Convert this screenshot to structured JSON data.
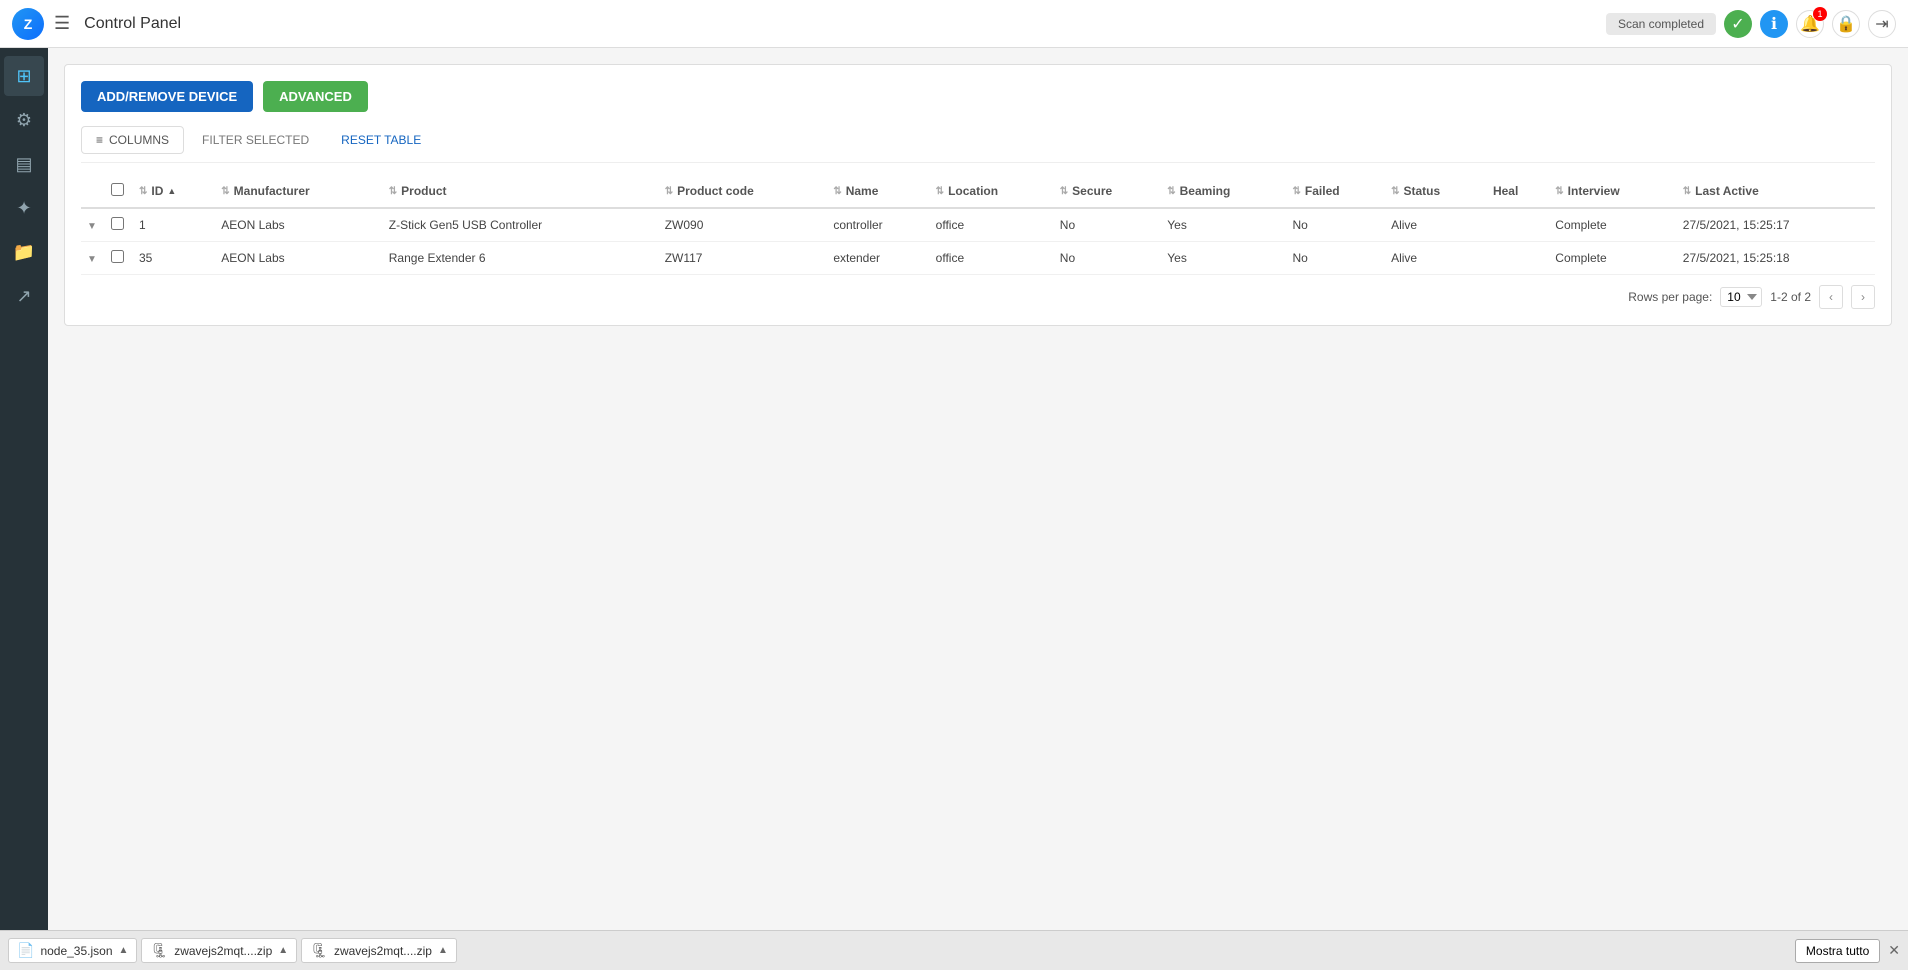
{
  "topbar": {
    "logo_text": "Z",
    "title": "Control Panel",
    "scan_status": "Scan completed"
  },
  "buttons": {
    "add_remove": "ADD/REMOVE DEVICE",
    "advanced": "ADVANCED"
  },
  "toolbar": {
    "columns": "COLUMNS",
    "filter_selected": "FILTER SELECTED",
    "reset_table": "RESET TABLE"
  },
  "table": {
    "columns": [
      {
        "key": "expand",
        "label": ""
      },
      {
        "key": "check",
        "label": ""
      },
      {
        "key": "id",
        "label": "ID"
      },
      {
        "key": "manufacturer",
        "label": "Manufacturer"
      },
      {
        "key": "product",
        "label": "Product"
      },
      {
        "key": "product_code",
        "label": "Product code"
      },
      {
        "key": "name",
        "label": "Name"
      },
      {
        "key": "location",
        "label": "Location"
      },
      {
        "key": "secure",
        "label": "Secure"
      },
      {
        "key": "beaming",
        "label": "Beaming"
      },
      {
        "key": "failed",
        "label": "Failed"
      },
      {
        "key": "status",
        "label": "Status"
      },
      {
        "key": "heal",
        "label": "Heal"
      },
      {
        "key": "interview",
        "label": "Interview"
      },
      {
        "key": "last_active",
        "label": "Last Active"
      }
    ],
    "rows": [
      {
        "id": "1",
        "manufacturer": "AEON Labs",
        "product": "Z-Stick Gen5 USB Controller",
        "product_code": "ZW090",
        "name": "controller",
        "location": "office",
        "secure": "No",
        "beaming": "Yes",
        "failed": "No",
        "status": "Alive",
        "heal": "",
        "interview": "Complete",
        "last_active": "27/5/2021, 15:25:17"
      },
      {
        "id": "35",
        "manufacturer": "AEON Labs",
        "product": "Range Extender 6",
        "product_code": "ZW117",
        "name": "extender",
        "location": "office",
        "secure": "No",
        "beaming": "Yes",
        "failed": "No",
        "status": "Alive",
        "heal": "",
        "interview": "Complete",
        "last_active": "27/5/2021, 15:25:18"
      }
    ]
  },
  "pagination": {
    "rows_per_page_label": "Rows per page:",
    "rows_per_page_value": "10",
    "range": "1-2 of 2"
  },
  "sidebar": {
    "items": [
      {
        "icon": "⊞",
        "name": "dashboard"
      },
      {
        "icon": "⚙",
        "name": "settings"
      },
      {
        "icon": "📊",
        "name": "analytics"
      },
      {
        "icon": "✦",
        "name": "plugins"
      },
      {
        "icon": "📁",
        "name": "files"
      },
      {
        "icon": "↗",
        "name": "share"
      }
    ]
  },
  "bottombar": {
    "downloads": [
      {
        "name": "node_35.json",
        "icon": "📄"
      },
      {
        "name": "zwavejs2mqt....zip",
        "icon": "🗜"
      },
      {
        "name": "zwavejs2mqt....zip",
        "icon": "🗜"
      }
    ],
    "show_all": "Mostra tutto"
  }
}
